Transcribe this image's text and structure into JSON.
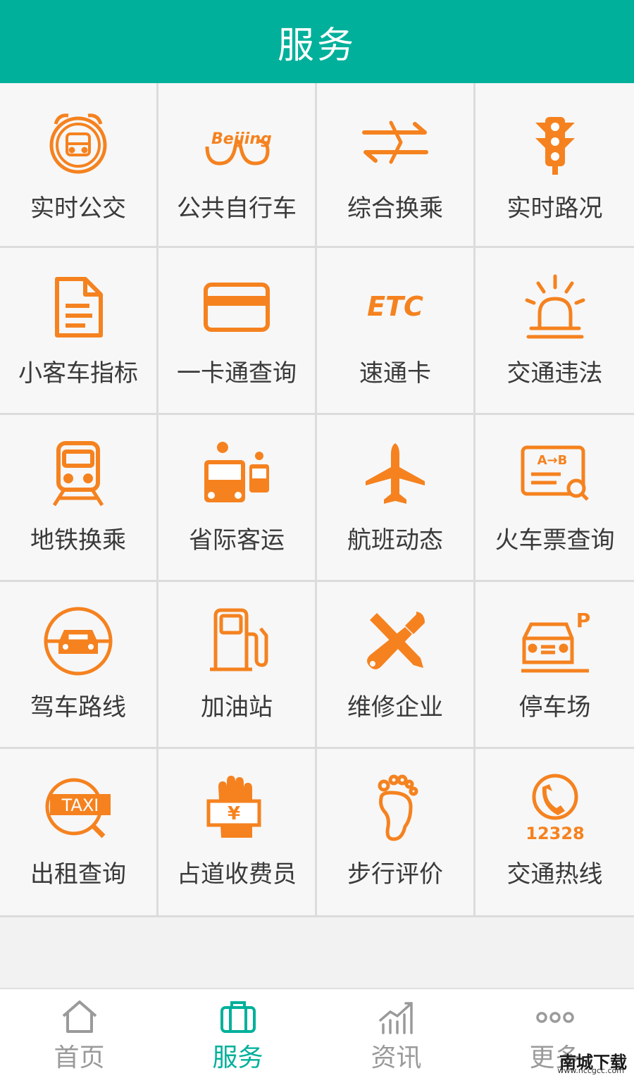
{
  "header": {
    "title": "服务"
  },
  "colors": {
    "accent": "#00b09b",
    "icon": "#f5821f",
    "text": "#3a3a3a",
    "tab_inactive": "#9a9a9a"
  },
  "services": [
    {
      "label": "实时公交",
      "icon": "alarm-bus-icon"
    },
    {
      "label": "公共自行车",
      "icon": "beijing-bike-icon"
    },
    {
      "label": "综合换乘",
      "icon": "transfer-arrows-icon"
    },
    {
      "label": "实时路况",
      "icon": "traffic-light-icon"
    },
    {
      "label": "小客车指标",
      "icon": "document-icon"
    },
    {
      "label": "一卡通查询",
      "icon": "card-icon"
    },
    {
      "label": "速通卡",
      "icon": "etc-icon",
      "icon_text": "ETC"
    },
    {
      "label": "交通违法",
      "icon": "alarm-light-icon"
    },
    {
      "label": "地铁换乘",
      "icon": "subway-icon"
    },
    {
      "label": "省际客运",
      "icon": "coach-icon"
    },
    {
      "label": "航班动态",
      "icon": "airplane-icon"
    },
    {
      "label": "火车票查询",
      "icon": "ticket-search-icon",
      "icon_text": "A→B"
    },
    {
      "label": "驾车路线",
      "icon": "car-circle-icon"
    },
    {
      "label": "加油站",
      "icon": "fuel-pump-icon"
    },
    {
      "label": "维修企业",
      "icon": "repair-tools-icon"
    },
    {
      "label": "停车场",
      "icon": "parking-icon",
      "icon_text": "P"
    },
    {
      "label": "出租查询",
      "icon": "taxi-search-icon",
      "icon_text": "TAXI"
    },
    {
      "label": "占道收费员",
      "icon": "hand-yuan-icon",
      "icon_text": "¥"
    },
    {
      "label": "步行评价",
      "icon": "footprint-icon"
    },
    {
      "label": "交通热线",
      "icon": "hotline-icon",
      "icon_text": "12328"
    }
  ],
  "tabs": [
    {
      "label": "首页",
      "icon": "home-icon",
      "active": false
    },
    {
      "label": "服务",
      "icon": "briefcase-icon",
      "active": true
    },
    {
      "label": "资讯",
      "icon": "chart-icon",
      "active": false
    },
    {
      "label": "更多",
      "icon": "more-dots-icon",
      "active": false
    }
  ],
  "watermark": {
    "title": "南城下载",
    "url": "www.nccgcc.com"
  }
}
